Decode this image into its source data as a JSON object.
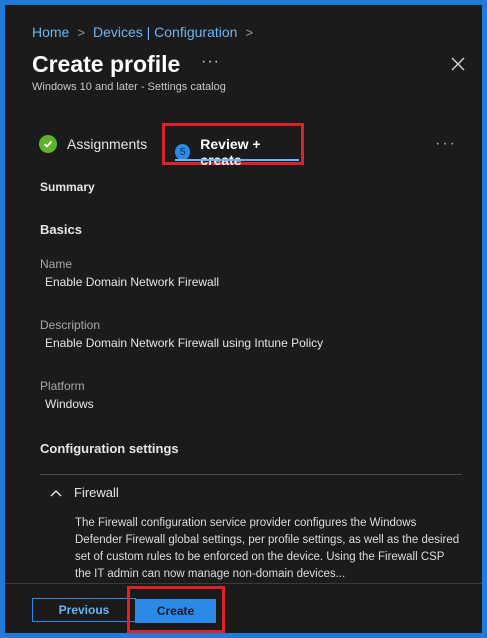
{
  "breadcrumb": {
    "items": [
      "Home",
      "Devices | Configuration"
    ],
    "separator": ">"
  },
  "header": {
    "title": "Create profile",
    "more": "···",
    "subtitle": "Windows 10 and later - Settings catalog"
  },
  "tabs": {
    "assignments": "Assignments",
    "review_step": "5",
    "review": "Review + create",
    "more": "···"
  },
  "summary": {
    "heading": "Summary",
    "basics_heading": "Basics",
    "name_label": "Name",
    "name_value": "Enable Domain Network Firewall",
    "description_label": "Description",
    "description_value": "Enable Domain Network Firewall using Intune Policy",
    "platform_label": "Platform",
    "platform_value": "Windows",
    "config_heading": "Configuration settings",
    "firewall_label": "Firewall",
    "firewall_description": "The Firewall configuration service provider configures the Windows Defender Firewall global settings, per profile settings, as well as the desired set of custom rules to be enforced on the device. Using the Firewall CSP the IT admin can now manage non-domain devices..."
  },
  "footer": {
    "previous_label": "Previous",
    "create_label": "Create"
  },
  "colors": {
    "accent": "#2b8ae6",
    "highlight_box": "#e0202c",
    "success": "#5db32e",
    "background": "#1b1b1b"
  }
}
